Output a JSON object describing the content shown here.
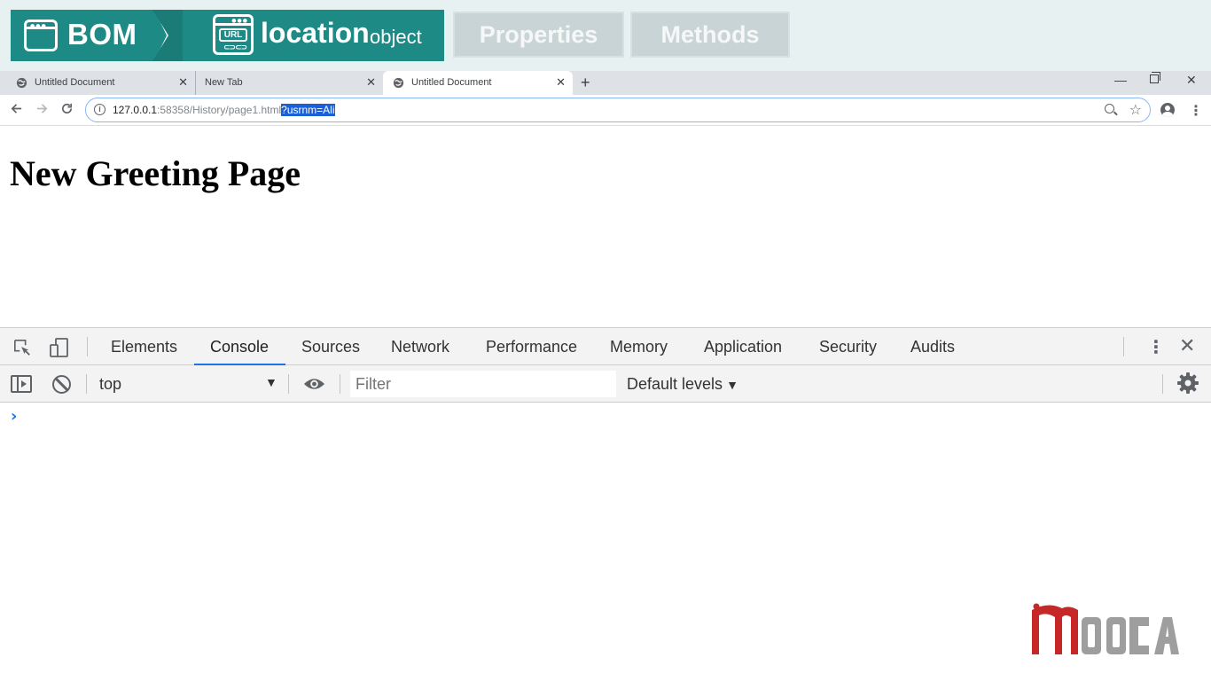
{
  "banner": {
    "bom_label": "BOM",
    "url_icon_text": "URL",
    "location_label": "location",
    "object_label": "object",
    "properties_label": "Properties",
    "methods_label": "Methods",
    "colors": {
      "teal": "#1e8a85",
      "pill": "#c9d4d6"
    }
  },
  "browser": {
    "tabs": [
      {
        "label": "Untitled Document",
        "icon": "globe-icon"
      },
      {
        "label": "New Tab"
      },
      {
        "label": "Untitled Document",
        "icon": "globe-icon",
        "active": true
      }
    ],
    "tab_close_glyph": "✕",
    "new_tab_glyph": "+",
    "window_min_glyph": "—",
    "window_close_glyph": "✕",
    "address": {
      "host": "127.0.0.1",
      "path": ":58358/History/page1.html",
      "selected": "?usrnm=Ali"
    }
  },
  "page": {
    "heading": "New Greeting Page"
  },
  "devtools": {
    "tabs": [
      "Elements",
      "Console",
      "Sources",
      "Network",
      "Performance",
      "Memory",
      "Application",
      "Security",
      "Audits"
    ],
    "active_tab": "Console",
    "context": "top",
    "filter_placeholder": "Filter",
    "levels": "Default levels",
    "prompt": "›",
    "colors": {
      "accent": "#1a73e8"
    }
  },
  "watermark": {
    "brand": "MOOCA",
    "colors": {
      "red": "#c62828",
      "gray": "#9e9e9e"
    }
  }
}
